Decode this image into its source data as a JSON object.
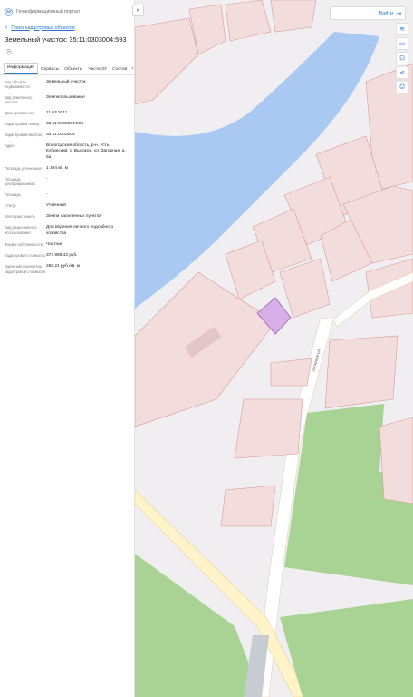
{
  "header": {
    "portal_name": "Геоинформационный портал",
    "collapse_label": "«",
    "login_label": "Войти"
  },
  "panel": {
    "back_label": "Поиск кадастровых объектов",
    "title": "Земельный участок: 35:11:0303004:593",
    "tabs": [
      {
        "label": "Информация",
        "active": true
      },
      {
        "label": "Сервисы",
        "active": false
      },
      {
        "label": "Объекты",
        "active": false
      },
      {
        "label": "Части ЗУ",
        "active": false
      },
      {
        "label": "Состав",
        "active": false
      }
    ],
    "tabs_more": "›",
    "properties": [
      {
        "label": "Вид объекта недвижимости",
        "value": "Земельный участок"
      },
      {
        "label": "Вид земельного участка",
        "value": "Землепользование"
      },
      {
        "label": "Дата присвоения",
        "value": "11.03.2011"
      },
      {
        "label": "Кадастровый номер",
        "value": "35:11:0303004:593"
      },
      {
        "label": "Кадастровый квартал",
        "value": "35:11:0303004"
      },
      {
        "label": "Адрес",
        "value": "Вологодская область, р-н. Усть-Кубинский, с. Высокое, ул. Загорная, д. 5а"
      },
      {
        "label": "Площадь уточненная",
        "value": "1 394 кв. м"
      },
      {
        "label": "Площадь декларированная",
        "value": "-"
      },
      {
        "label": "Площадь",
        "value": "-"
      },
      {
        "label": "Статус",
        "value": "Учтенный"
      },
      {
        "label": "Категория земель",
        "value": "Земли населенных пунктов"
      },
      {
        "label": "Вид разрешенного использования",
        "value": "Для ведения личного подсобного хозяйства"
      },
      {
        "label": "Форма собственности",
        "value": "Частная"
      },
      {
        "label": "Кадастровая стоимость",
        "value": "373 889,42 руб."
      },
      {
        "label": "Удельный показатель кадастровой стоимости",
        "value": "268,21 руб./кв. м"
      }
    ]
  },
  "map": {
    "street_label": "Загорная ул.",
    "colors": {
      "background": "#f1eef1",
      "water": "#a9c9f2",
      "parcel": "#f3dcdc",
      "parcel_stroke": "#d49b9b",
      "green": "#a9d395",
      "selected": "#d7afe6"
    }
  }
}
